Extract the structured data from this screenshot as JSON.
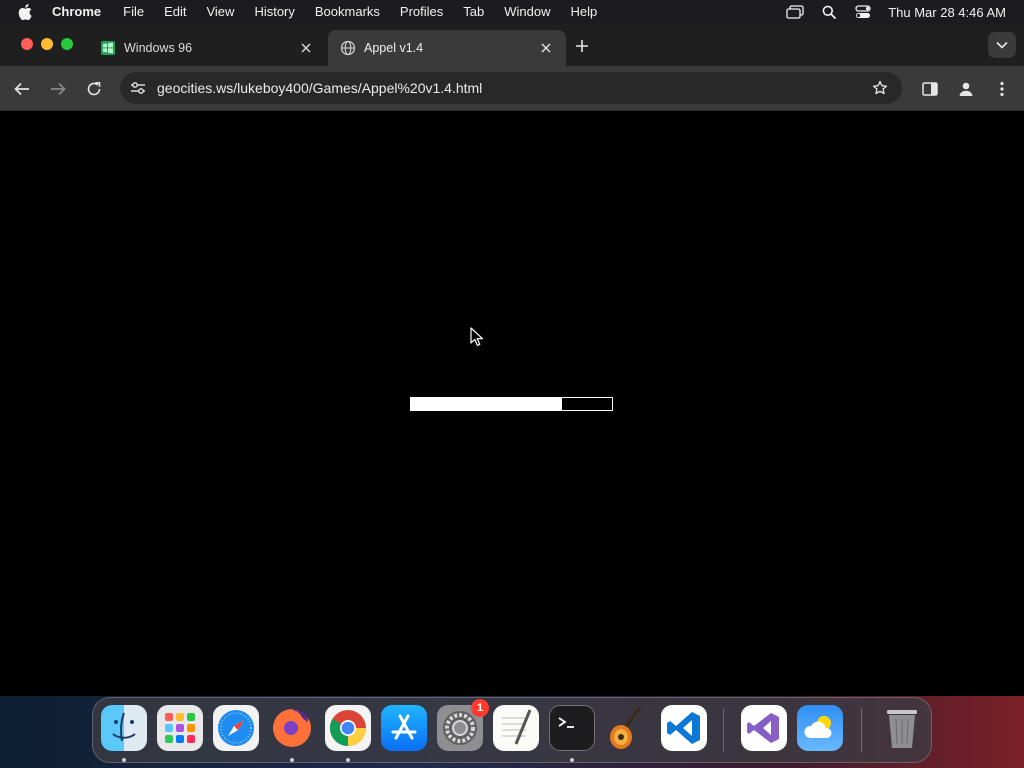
{
  "menubar": {
    "app_name": "Chrome",
    "items": [
      "File",
      "Edit",
      "View",
      "History",
      "Bookmarks",
      "Profiles",
      "Tab",
      "Window",
      "Help"
    ],
    "clock": "Thu Mar 28  4:46 AM",
    "icons": [
      "apple-logo",
      "screen-mirroring-icon",
      "search-icon",
      "control-center-icon"
    ]
  },
  "browser": {
    "tabs": [
      {
        "title": "Windows 96",
        "favicon": "windows96-favicon",
        "active": false
      },
      {
        "title": "Appel v1.4",
        "favicon": "globe-favicon",
        "active": true
      }
    ],
    "url": "geocities.ws/lukeboy400/Games/Appel%20v1.4.html"
  },
  "page": {
    "loading_progress": 0.75
  },
  "dock": {
    "apps": [
      {
        "name": "Finder",
        "icon": "finder-icon",
        "running": true
      },
      {
        "name": "Launchpad",
        "icon": "launchpad-icon",
        "running": false
      },
      {
        "name": "Safari",
        "icon": "safari-icon",
        "running": false
      },
      {
        "name": "Firefox",
        "icon": "firefox-icon",
        "running": true
      },
      {
        "name": "Chrome",
        "icon": "chrome-icon",
        "running": true
      },
      {
        "name": "App Store",
        "icon": "app-store-icon",
        "running": false
      },
      {
        "name": "System Settings",
        "icon": "system-settings-icon",
        "running": false,
        "badge": "1"
      },
      {
        "name": "TextEdit",
        "icon": "textedit-icon",
        "running": false
      },
      {
        "name": "Terminal",
        "icon": "terminal-icon",
        "running": true
      },
      {
        "name": "GarageBand",
        "icon": "garageband-icon",
        "running": false
      },
      {
        "name": "Visual Studio Code",
        "icon": "vscode-icon",
        "running": false
      },
      {
        "name": "Visual Studio",
        "icon": "visual-studio-icon",
        "running": false
      },
      {
        "name": "Weather",
        "icon": "weather-icon",
        "running": false
      },
      {
        "name": "Trash",
        "icon": "trash-icon",
        "running": false
      }
    ]
  },
  "colors": {
    "menubar_bg": "#1c1c1e",
    "tabstrip_bg": "#1f1f1f",
    "toolbar_bg": "#3a3a3a",
    "page_bg": "#000000",
    "loader": "#ffffff"
  }
}
